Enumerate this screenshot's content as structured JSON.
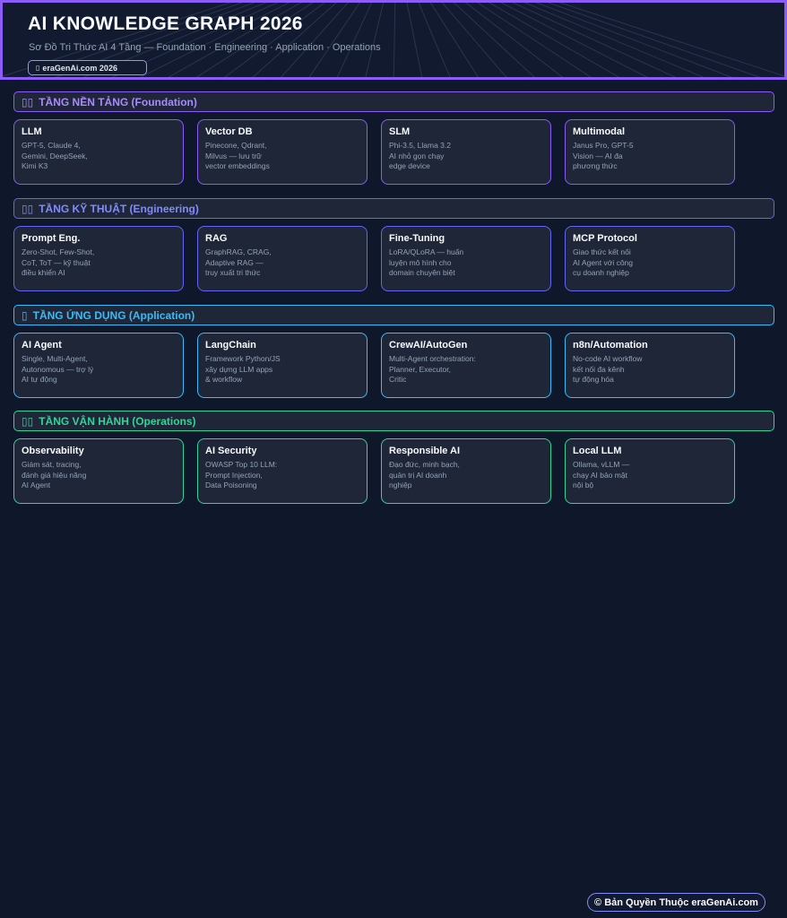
{
  "header": {
    "title": "AI KNOWLEDGE GRAPH 2026",
    "subtitle": "Sơ Đồ Tri Thức AI 4 Tầng — Foundation · Engineering · Application · Operations",
    "badge_glyph": "▯",
    "badge_text": "eraGenAi.com 2026"
  },
  "colors": {
    "foundation": "#8b5cf6",
    "engineering": "#6366f1",
    "application": "#38bdf8",
    "operations": "#34d399",
    "background": "#0f172a",
    "card_background": "#1e2638"
  },
  "tiers": [
    {
      "glyph": "▯▯",
      "label": "TẦNG NỀN TẢNG (Foundation)",
      "cards": [
        {
          "title": "LLM",
          "desc": "GPT-5, Claude 4,\nGemini, DeepSeek,\nKimi K3"
        },
        {
          "title": "Vector DB",
          "desc": "Pinecone, Qdrant,\nMilvus — lưu trữ\nvector embeddings"
        },
        {
          "title": "SLM",
          "desc": "Phi-3.5, Llama 3.2\nAI nhỏ gọn chạy\nedge device"
        },
        {
          "title": "Multimodal",
          "desc": "Janus Pro, GPT-5\nVision — AI đa\nphương thức"
        }
      ]
    },
    {
      "glyph": "▯▯",
      "label": "TẦNG KỸ THUẬT (Engineering)",
      "cards": [
        {
          "title": "Prompt Eng.",
          "desc": "Zero-Shot, Few-Shot,\nCoT, ToT — kỹ thuật\nđiều khiển AI"
        },
        {
          "title": "RAG",
          "desc": "GraphRAG, CRAG,\nAdaptive RAG —\ntruy xuất tri thức"
        },
        {
          "title": "Fine-Tuning",
          "desc": "LoRA/QLoRA — huấn\nluyện mô hình cho\ndomain chuyên biệt"
        },
        {
          "title": "MCP Protocol",
          "desc": "Giao thức kết nối\nAI Agent với công\ncụ doanh nghiệp"
        }
      ]
    },
    {
      "glyph": "▯",
      "label": "TẦNG ỨNG DỤNG (Application)",
      "cards": [
        {
          "title": "AI Agent",
          "desc": "Single, Multi-Agent,\nAutonomous — trợ lý\nAI tự động"
        },
        {
          "title": "LangChain",
          "desc": "Framework Python/JS\nxây dựng LLM apps\n& workflow"
        },
        {
          "title": "CrewAI/AutoGen",
          "desc": "Multi-Agent orchestration:\nPlanner, Executor,\nCritic"
        },
        {
          "title": "n8n/Automation",
          "desc": "No-code AI workflow\nkết nối đa kênh\ntự động hóa"
        }
      ]
    },
    {
      "glyph": "▯▯",
      "label": "TẦNG VẬN HÀNH (Operations)",
      "cards": [
        {
          "title": "Observability",
          "desc": "Giám sát, tracing,\nđánh giá hiệu năng\nAI Agent"
        },
        {
          "title": "AI Security",
          "desc": "OWASP Top 10 LLM:\nPrompt Injection,\nData Poisoning"
        },
        {
          "title": "Responsible AI",
          "desc": "Đạo đức, minh bạch,\nquản trị AI doanh\nnghiệp"
        },
        {
          "title": "Local LLM",
          "desc": "Ollama, vLLM —\nchạy AI bảo mật\nnội bộ"
        }
      ]
    }
  ],
  "footer": {
    "copyright": "© Bản Quyền Thuộc eraGenAi.com"
  }
}
